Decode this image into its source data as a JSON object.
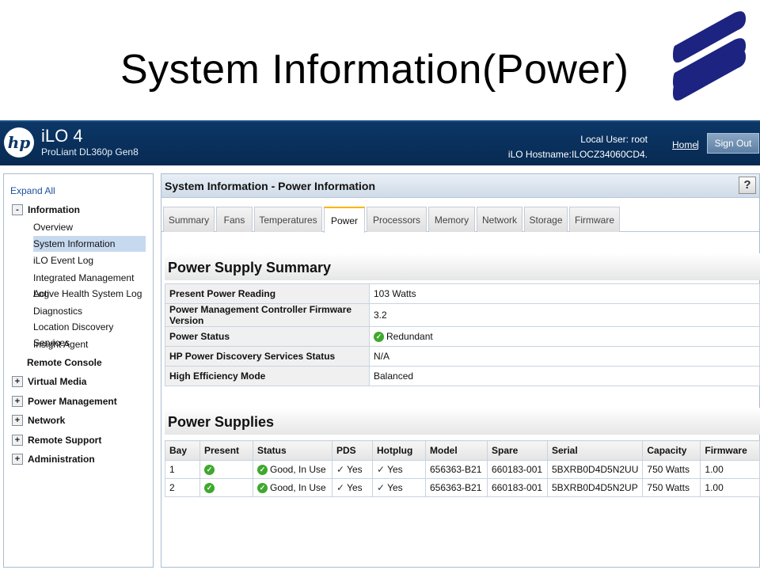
{
  "slide": {
    "title": "System Information(Power)"
  },
  "header": {
    "logo_text": "hp",
    "product": "iLO 4",
    "model": "ProLiant DL360p Gen8",
    "local_user": "Local User:  root",
    "hostname": "iLO Hostname:ILOCZ34060CD4.",
    "home": "Home",
    "separator": "|",
    "sign_out": "Sign Out"
  },
  "sidebar": {
    "expand_all": "Expand All",
    "information": {
      "toggle": "-",
      "label": "Information"
    },
    "items": [
      "Overview",
      "System Information",
      "iLO Event Log",
      "Integrated Management Log",
      "Active Health System Log",
      "Diagnostics",
      "Location Discovery Services",
      "Insight Agent"
    ],
    "remote_console": "Remote Console",
    "groups": [
      {
        "toggle": "+",
        "label": "Virtual Media"
      },
      {
        "toggle": "+",
        "label": "Power Management"
      },
      {
        "toggle": "+",
        "label": "Network"
      },
      {
        "toggle": "+",
        "label": "Remote Support"
      },
      {
        "toggle": "+",
        "label": "Administration"
      }
    ]
  },
  "main": {
    "title": "System Information - Power Information",
    "help": "?",
    "tabs": [
      "Summary",
      "Fans",
      "Temperatures",
      "Power",
      "Processors",
      "Memory",
      "Network",
      "Storage",
      "Firmware"
    ],
    "active_tab": "Power",
    "summary_heading": "Power Supply Summary",
    "summary": [
      {
        "label": "Present Power Reading",
        "value": "103 Watts"
      },
      {
        "label": "Power Management Controller Firmware Version",
        "value": "3.2"
      },
      {
        "label": "Power Status",
        "value": "Redundant"
      },
      {
        "label": "HP Power Discovery Services Status",
        "value": "N/A"
      },
      {
        "label": "High Efficiency Mode",
        "value": "Balanced"
      }
    ],
    "supplies_heading": "Power Supplies",
    "columns": [
      "Bay",
      "Present",
      "Status",
      "PDS",
      "Hotplug",
      "Model",
      "Spare",
      "Serial",
      "Capacity",
      "Firmware"
    ],
    "rows": [
      {
        "bay": "1",
        "status": "Good, In Use",
        "pds": "Yes",
        "hotplug": "Yes",
        "model": "656363-B21",
        "spare": "660183-001",
        "serial": "5BXRB0D4D5N2UU",
        "capacity": "750 Watts",
        "firmware": "1.00"
      },
      {
        "bay": "2",
        "status": "Good, In Use",
        "pds": "Yes",
        "hotplug": "Yes",
        "model": "656363-B21",
        "spare": "660183-001",
        "serial": "5BXRB0D4D5N2UP",
        "capacity": "750 Watts",
        "firmware": "1.00"
      }
    ]
  },
  "colors": {
    "header_bg": "#0c3767",
    "brand_logo": "#1d2380",
    "ok_green": "#3fa82e",
    "selected_nav": "#c7d9ef",
    "active_tab_accent": "#ffb400"
  }
}
